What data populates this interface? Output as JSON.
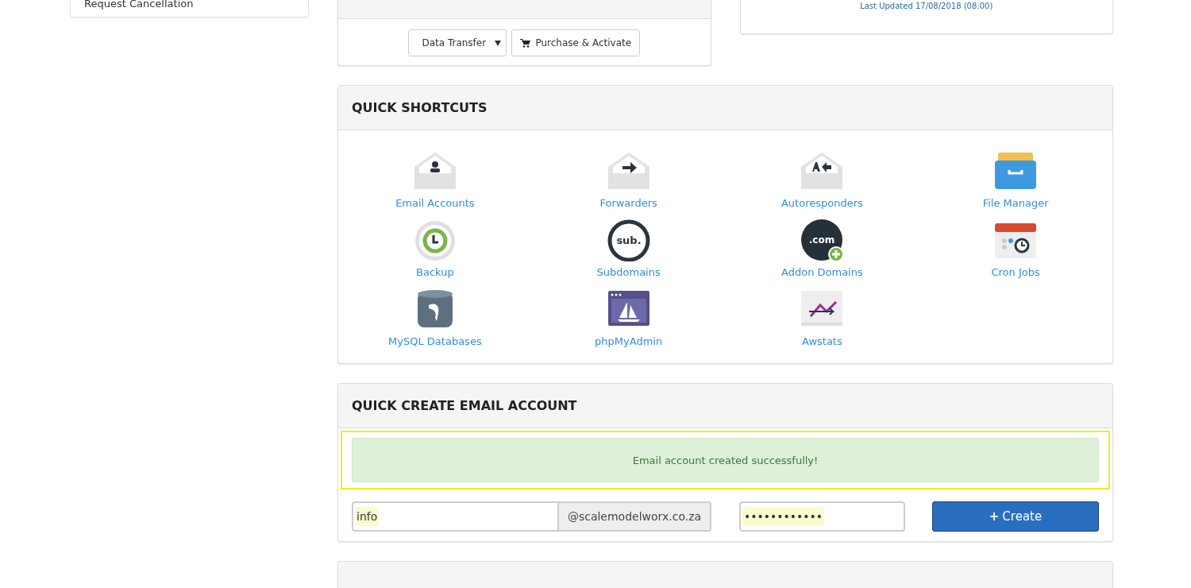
{
  "sidebar": {
    "items": [
      "Request Cancellation"
    ]
  },
  "upgrade_panel": {
    "dropdown": "Data Transfer",
    "button": "Purchase & Activate"
  },
  "usage_panel": {
    "last_updated": "Last Updated 17/08/2018 (08:00)"
  },
  "quick_shortcuts": {
    "title": "QUICK SHORTCUTS",
    "items": [
      {
        "label": "Email Accounts",
        "kind": "email-person"
      },
      {
        "label": "Forwarders",
        "kind": "email-arrow"
      },
      {
        "label": "Autoresponders",
        "kind": "email-reply"
      },
      {
        "label": "File Manager",
        "kind": "drawer"
      },
      {
        "label": "Backup",
        "kind": "backup"
      },
      {
        "label": "Subdomains",
        "kind": "sub",
        "icon_text": "sub."
      },
      {
        "label": "Addon Domains",
        "kind": "com",
        "icon_text": ".com"
      },
      {
        "label": "Cron Jobs",
        "kind": "calendar"
      },
      {
        "label": "MySQL Databases",
        "kind": "database"
      },
      {
        "label": "phpMyAdmin",
        "kind": "window"
      },
      {
        "label": "Awstats",
        "kind": "chart"
      }
    ]
  },
  "quick_create_email": {
    "title": "QUICK CREATE EMAIL ACCOUNT",
    "alert": "Email account created successfully!",
    "username": "info",
    "domain": "@scalemodelworx.co.za",
    "password": "••••••••••••",
    "button": "Create",
    "button_icon": "+"
  }
}
